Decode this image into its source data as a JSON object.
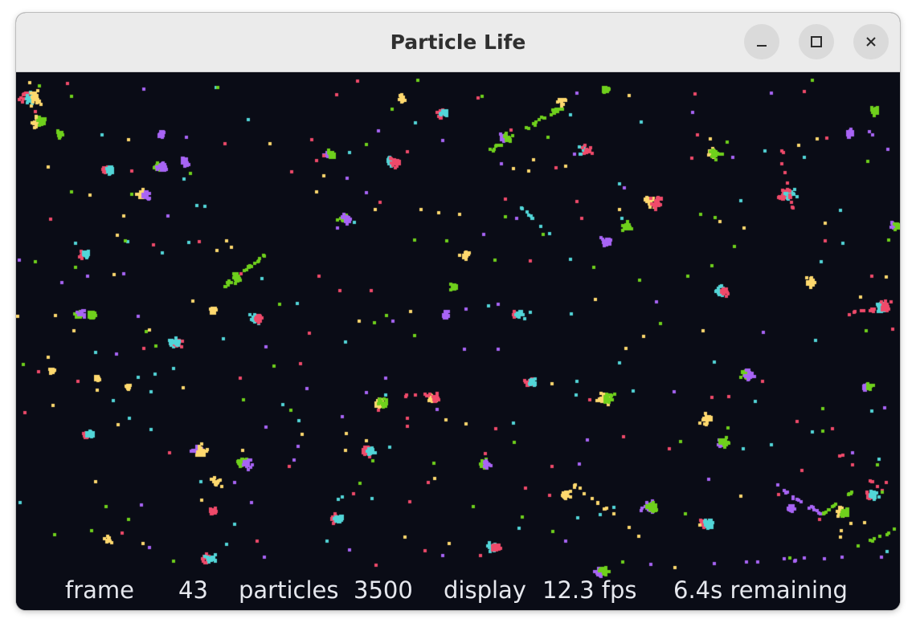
{
  "window": {
    "title": "Particle Life",
    "controls": {
      "minimize_icon": "minimize-icon",
      "maximize_icon": "maximize-icon",
      "close_icon": "close-icon"
    }
  },
  "status": {
    "frame_label": "frame",
    "frame_value": "43",
    "particles_label": "particles",
    "particles_value": "3500",
    "display_label": "display",
    "fps_value": "12.3 fps",
    "remaining": "6.4s remaining"
  },
  "colors": {
    "background": "#0a0c16",
    "species": [
      "#f04a6a",
      "#52d6d8",
      "#ffd96e",
      "#6fd01c",
      "#a864f5"
    ]
  }
}
